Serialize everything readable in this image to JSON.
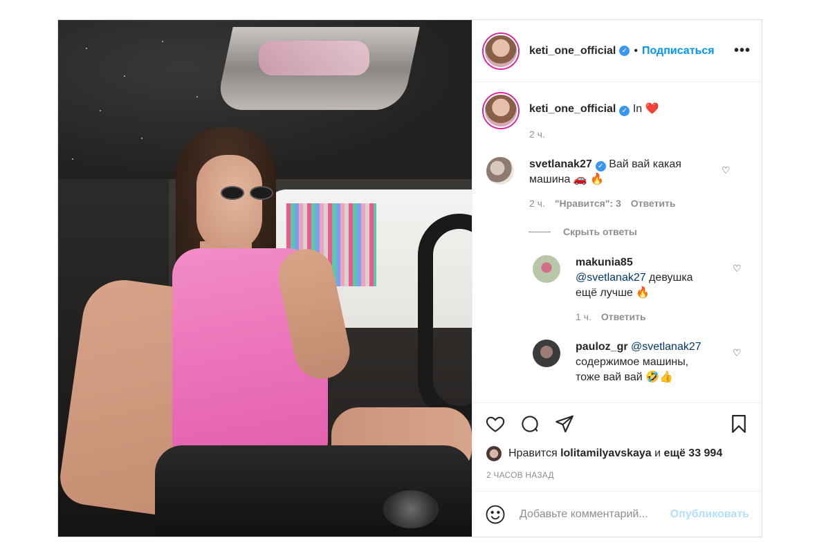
{
  "post": {
    "author": "keti_one_official",
    "follow_label": "Подписаться",
    "separator": "•",
    "more_icon": "more-dots-icon"
  },
  "caption": {
    "username": "keti_one_official",
    "text": "In",
    "emoji": "❤️",
    "time": "2 ч."
  },
  "comments": [
    {
      "username": "svetlanak27",
      "verified": true,
      "text_line1": "Вай вай какая",
      "text_line2": "машина",
      "emoji": "🚗 🔥",
      "time": "2 ч.",
      "likes": "\"Нравится\": 3",
      "reply_label": "Ответить"
    }
  ],
  "hide_replies_label": "Скрыть ответы",
  "replies": [
    {
      "username": "makunia85",
      "mention": "@svetlanak27",
      "text_a": "девушка",
      "text_b": "ещё лучше",
      "emoji": "🔥",
      "time": "1 ч.",
      "reply_label": "Ответить"
    },
    {
      "username": "pauloz_gr",
      "mention": "@svetlanak27",
      "text_a": "содержимое машины,",
      "text_b": "тоже вай вай",
      "emoji": "🤣👍"
    }
  ],
  "likes": {
    "prefix": "Нравится",
    "user": "lolitamilyavskaya",
    "conj": "и",
    "rest": "ещё 33 994"
  },
  "timeago": "2 ЧАСОВ НАЗАД",
  "comment_box": {
    "placeholder": "Добавьте комментарий...",
    "publish_label": "Опубликовать"
  },
  "colors": {
    "accent": "#0095f6",
    "verified": "#3897f0",
    "publish_disabled": "#b2dffc",
    "secondary_text": "#8e8e8e"
  }
}
